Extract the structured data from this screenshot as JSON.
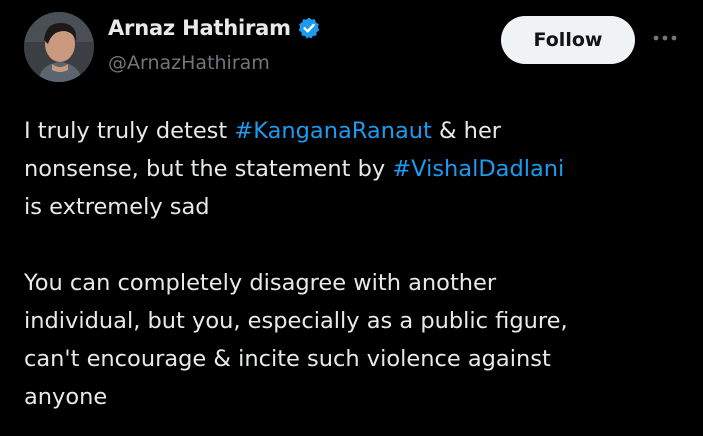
{
  "author": {
    "display_name": "Arnaz Hathiram",
    "handle": "@ArnazHathiram",
    "avatar_icon": "profile-photo",
    "verified_icon": "verified-badge-icon",
    "verified_color": "#1d9bf0"
  },
  "actions": {
    "follow_label": "Follow",
    "more_icon": "more-options-icon"
  },
  "tweet": {
    "paragraph1": {
      "line1_prefix": "I truly truly detest ",
      "line1_hashtag": "#KanganaRanaut",
      "line1_suffix": " & her",
      "line2_prefix": "nonsense, but the statement by ",
      "line2_hashtag": "#VishalDadlani",
      "line3": "is extremely sad"
    },
    "paragraph2": {
      "line1": "You can completely disagree with another",
      "line2": "individual, but you, especially as a public figure,",
      "line3": "can't encourage & incite such violence against",
      "line4": "anyone"
    }
  },
  "colors": {
    "background": "#000000",
    "text": "#e7e9ea",
    "secondary_text": "#71767b",
    "link": "#1d9bf0",
    "follow_button_bg": "#eff3f4",
    "follow_button_text": "#0f1419"
  }
}
